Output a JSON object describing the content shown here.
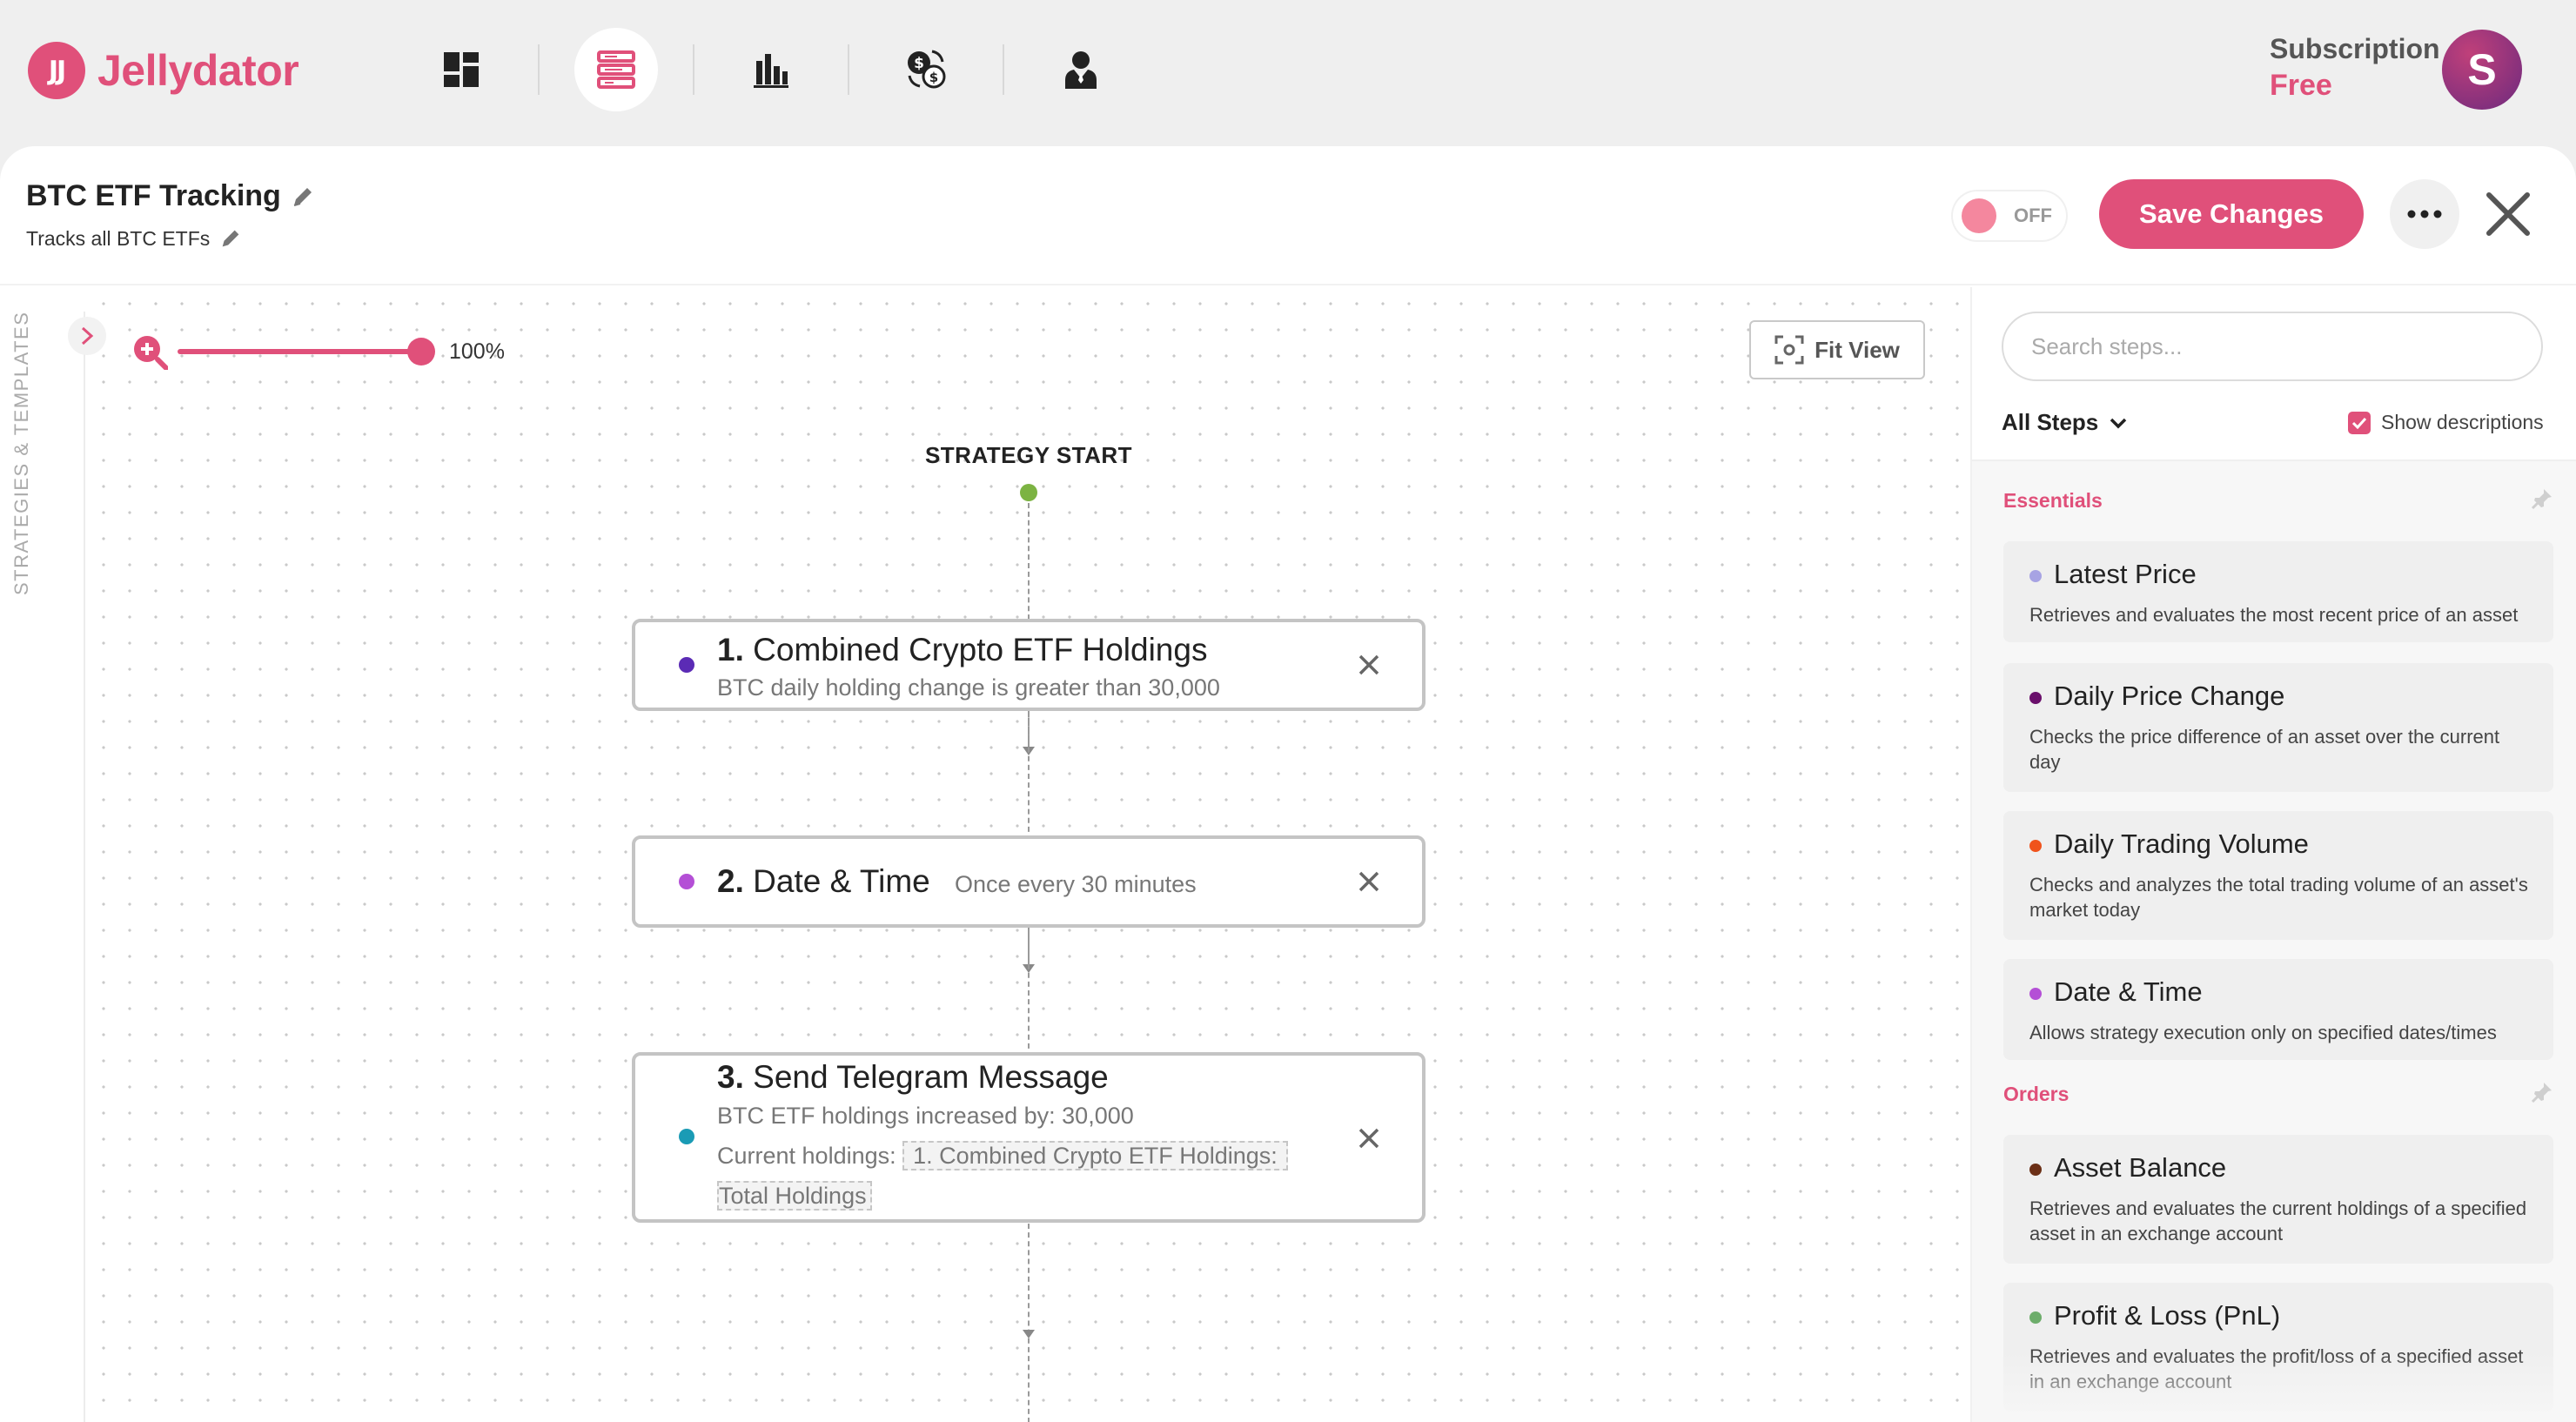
{
  "app": {
    "brand": "Jellydator",
    "logo_mark": "JJ",
    "accent_color": "#e0507a"
  },
  "nav": {
    "icons": [
      {
        "name": "dashboard-icon",
        "active": false
      },
      {
        "name": "strategies-icon",
        "active": true
      },
      {
        "name": "chart-icon",
        "active": false
      },
      {
        "name": "currency-exchange-icon",
        "active": false
      },
      {
        "name": "user-icon",
        "active": false
      }
    ]
  },
  "subscription": {
    "label": "Subscription",
    "plan": "Free"
  },
  "user": {
    "avatar_letter": "S"
  },
  "strategy": {
    "title": "BTC ETF Tracking",
    "description": "Tracks all BTC ETFs",
    "toggle_state": "OFF",
    "save_label": "Save Changes"
  },
  "canvas": {
    "rail_label": "STRATEGIES & TEMPLATES",
    "zoom_level": "100%",
    "zoom_fraction": 1.0,
    "fit_view_label": "Fit View",
    "start_label": "STRATEGY START",
    "steps": [
      {
        "number": "1.",
        "title": "Combined Crypto ETF Holdings",
        "description": "BTC daily holding change is greater than 30,000",
        "dot_color": "#5b2bb5"
      },
      {
        "number": "2.",
        "title": "Date & Time",
        "description": "Once every 30 minutes",
        "dot_color": "#b44fd6"
      },
      {
        "number": "3.",
        "title": "Send Telegram Message",
        "line1": "BTC ETF holdings increased by: 30,000",
        "line2_prefix": "Current holdings:",
        "chip_line1": "1. Combined Crypto ETF Holdings:",
        "chip_line2": "Total Holdings",
        "dot_color": "#1a9bb5"
      }
    ]
  },
  "sidebar": {
    "search_placeholder": "Search steps...",
    "filter_label": "All Steps",
    "show_descriptions_label": "Show descriptions",
    "show_descriptions_checked": true,
    "sections": [
      {
        "label": "Essentials",
        "items": [
          {
            "title": "Latest Price",
            "description": "Retrieves and evaluates the most recent price of an asset",
            "dot_color": "#a7a3e3"
          },
          {
            "title": "Daily Price Change",
            "description": "Checks the price difference of an asset over the current day",
            "dot_color": "#6a0f6b"
          },
          {
            "title": "Daily Trading Volume",
            "description": "Checks and analyzes the total trading volume of an asset's market today",
            "dot_color": "#f0531c"
          },
          {
            "title": "Date & Time",
            "description": "Allows strategy execution only on specified dates/times",
            "dot_color": "#b44fd6"
          }
        ]
      },
      {
        "label": "Orders",
        "items": [
          {
            "title": "Asset Balance",
            "description": "Retrieves and evaluates the current holdings of a specified asset in an exchange account",
            "dot_color": "#6b2f16"
          },
          {
            "title": "Profit & Loss (PnL)",
            "description": "Retrieves and evaluates the profit/loss of a specified asset in an exchange account",
            "dot_color": "#6dad6b"
          }
        ]
      }
    ]
  }
}
